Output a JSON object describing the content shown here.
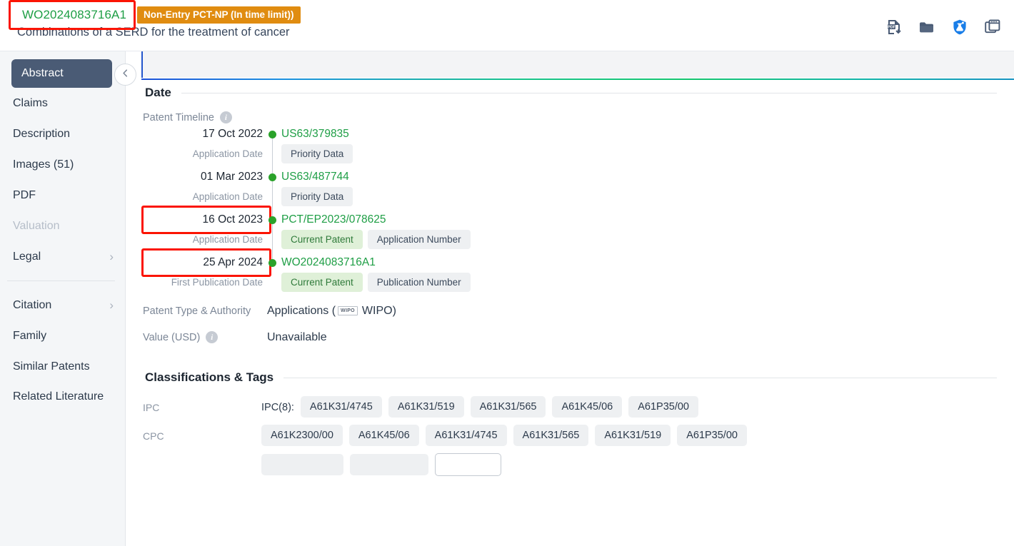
{
  "header": {
    "publication_number": "WO2024083716A1",
    "status_badge": "Non-Entry PCT-NP (In time limit))",
    "title": "Combinations of a SERD for the treatment of cancer",
    "icons": [
      {
        "name": "pdf-download-icon",
        "label": "PDF"
      },
      {
        "name": "folder-icon",
        "label": "Folder"
      },
      {
        "name": "chemical-badge-icon",
        "label": "Chemistry"
      },
      {
        "name": "duplicate-window-icon",
        "label": "Compare"
      }
    ]
  },
  "sidebar": {
    "items": [
      {
        "label": "Abstract",
        "active": true,
        "disabled": false,
        "chevron": false
      },
      {
        "label": "Claims",
        "active": false,
        "disabled": false,
        "chevron": false
      },
      {
        "label": "Description",
        "active": false,
        "disabled": false,
        "chevron": false
      },
      {
        "label": "Images (51)",
        "active": false,
        "disabled": false,
        "chevron": false
      },
      {
        "label": "PDF",
        "active": false,
        "disabled": false,
        "chevron": false
      },
      {
        "label": "Valuation",
        "active": false,
        "disabled": true,
        "chevron": false
      },
      {
        "label": "Legal",
        "active": false,
        "disabled": false,
        "chevron": true
      }
    ],
    "items_lower": [
      {
        "label": "Citation",
        "active": false,
        "disabled": false,
        "chevron": true
      },
      {
        "label": "Family",
        "active": false,
        "disabled": false,
        "chevron": false
      },
      {
        "label": "Similar Patents",
        "active": false,
        "disabled": false,
        "chevron": false
      },
      {
        "label": "Related Literature",
        "active": false,
        "disabled": false,
        "chevron": false
      }
    ],
    "collapse_icon": "chevron-left-icon"
  },
  "date_section": {
    "heading": "Date",
    "timeline_label": "Patent Timeline",
    "entries": [
      {
        "date": "17 Oct 2022",
        "highlighted": false,
        "sublabel": "Application Date",
        "number": "US63/379835",
        "tags": [
          {
            "text": "Priority Data",
            "style": "gray"
          }
        ]
      },
      {
        "date": "01 Mar 2023",
        "highlighted": false,
        "sublabel": "Application Date",
        "number": "US63/487744",
        "tags": [
          {
            "text": "Priority Data",
            "style": "gray"
          }
        ]
      },
      {
        "date": "16 Oct 2023",
        "highlighted": true,
        "sublabel": "Application Date",
        "number": "PCT/EP2023/078625",
        "tags": [
          {
            "text": "Current Patent",
            "style": "green"
          },
          {
            "text": "Application Number",
            "style": "gray"
          }
        ]
      },
      {
        "date": "25 Apr 2024",
        "highlighted": true,
        "sublabel": "First Publication Date",
        "number": "WO2024083716A1",
        "tags": [
          {
            "text": "Current Patent",
            "style": "green"
          },
          {
            "text": "Publication Number",
            "style": "gray"
          }
        ]
      }
    ],
    "type_label": "Patent Type & Authority",
    "type_value_prefix": "Applications (",
    "type_authority_logo": "WIPO",
    "type_authority": "WIPO)",
    "value_label": "Value (USD)",
    "value_value": "Unavailable"
  },
  "classifications": {
    "heading": "Classifications & Tags",
    "rows": [
      {
        "label": "IPC",
        "prefix": "IPC(8):",
        "tags": [
          "A61K31/4745",
          "A61K31/519",
          "A61K31/565",
          "A61K45/06",
          "A61P35/00"
        ]
      },
      {
        "label": "CPC",
        "prefix": "",
        "tags": [
          "A61K2300/00",
          "A61K45/06",
          "A61K31/4745",
          "A61K31/565",
          "A61K31/519",
          "A61P35/00"
        ]
      }
    ]
  },
  "colors": {
    "accent_green": "#1e9e45",
    "status_orange": "#e08c10",
    "highlight_red": "#fb1403",
    "sidebar_active": "#4a5b75",
    "tag_green_bg": "#dff0d8"
  }
}
